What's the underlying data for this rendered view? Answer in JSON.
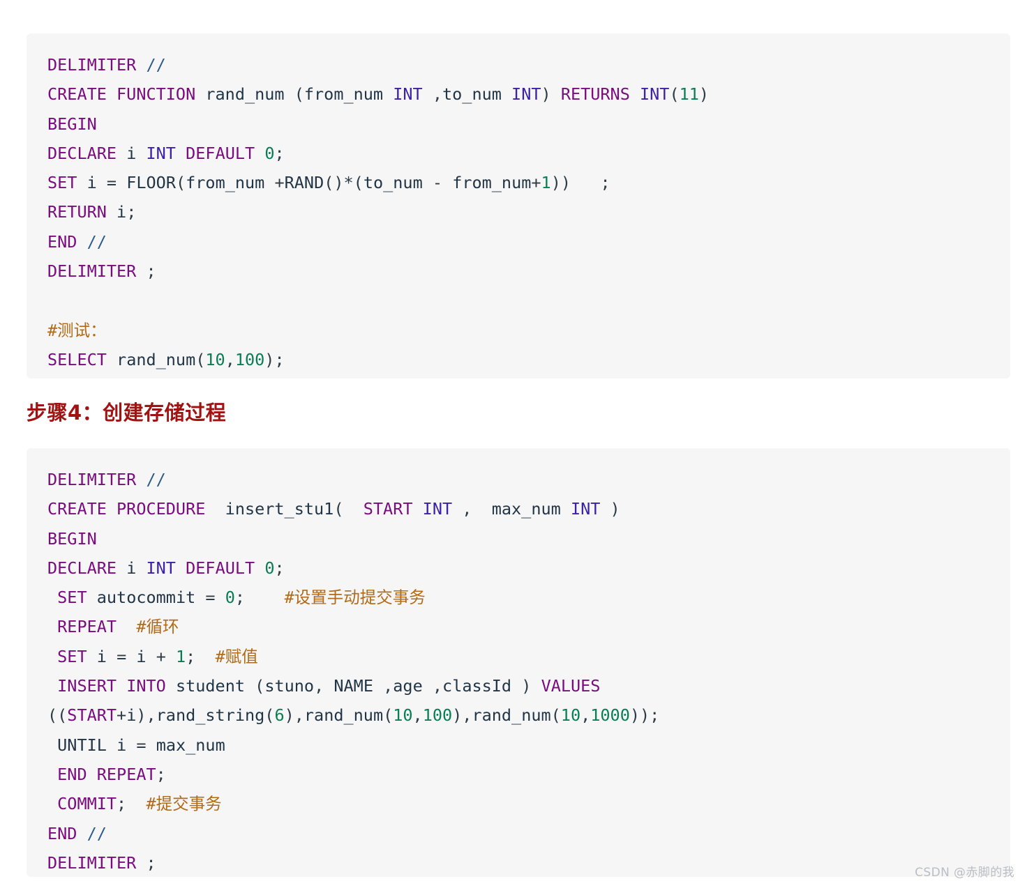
{
  "page": {
    "background_color": "#ffffff",
    "code_block_background": "#f6f6f6"
  },
  "colors": {
    "keyword": "#7a0c80",
    "type": "#3c21a8",
    "operator": "#2b5b8c",
    "number": "#0a7d55",
    "identifier": "#213547",
    "comment": "#b26a17",
    "heading": "#a01313",
    "watermark": "#b9bec4"
  },
  "code_block_1": {
    "language": "sql",
    "plain_text": "DELIMITER //\nCREATE FUNCTION rand_num (from_num INT ,to_num INT) RETURNS INT(11)\nBEGIN\nDECLARE i INT DEFAULT 0;\nSET i = FLOOR(from_num +RAND()*(to_num - from_num+1))   ;\nRETURN i;\nEND //\nDELIMITER ;\n\n#测试：\nSELECT rand_num(10,100);",
    "lines": [
      "DELIMITER //",
      "CREATE FUNCTION rand_num (from_num INT ,to_num INT) RETURNS INT(11)",
      "BEGIN",
      "DECLARE i INT DEFAULT 0;",
      "SET i = FLOOR(from_num +RAND()*(to_num - from_num+1))   ;",
      "RETURN i;",
      "END //",
      "DELIMITER ;",
      "",
      "#测试：",
      "SELECT rand_num(10,100);"
    ]
  },
  "heading": {
    "text": "步骤4：创建存储过程"
  },
  "code_block_2": {
    "language": "sql",
    "plain_text": "DELIMITER //\nCREATE PROCEDURE  insert_stu1(  START INT ,  max_num INT )\nBEGIN\nDECLARE i INT DEFAULT 0;\n SET autocommit = 0;    #设置手动提交事务\n REPEAT  #循环\n SET i = i + 1;  #赋值\n INSERT INTO student (stuno, NAME ,age ,classId ) VALUES\n((START+i),rand_string(6),rand_num(10,100),rand_num(10,1000));\n UNTIL i = max_num\n END REPEAT;\n COMMIT;  #提交事务\nEND //\nDELIMITER ;",
    "lines": [
      "DELIMITER //",
      "CREATE PROCEDURE  insert_stu1(  START INT ,  max_num INT )",
      "BEGIN",
      "DECLARE i INT DEFAULT 0;",
      " SET autocommit = 0;    #设置手动提交事务",
      " REPEAT  #循环",
      " SET i = i + 1;  #赋值",
      " INSERT INTO student (stuno, NAME ,age ,classId ) VALUES",
      "((START+i),rand_string(6),rand_num(10,100),rand_num(10,1000));",
      " UNTIL i = max_num",
      " END REPEAT;",
      " COMMIT;  #提交事务",
      "END //",
      "DELIMITER ;"
    ]
  },
  "watermark": {
    "text": "CSDN @赤脚的我"
  }
}
